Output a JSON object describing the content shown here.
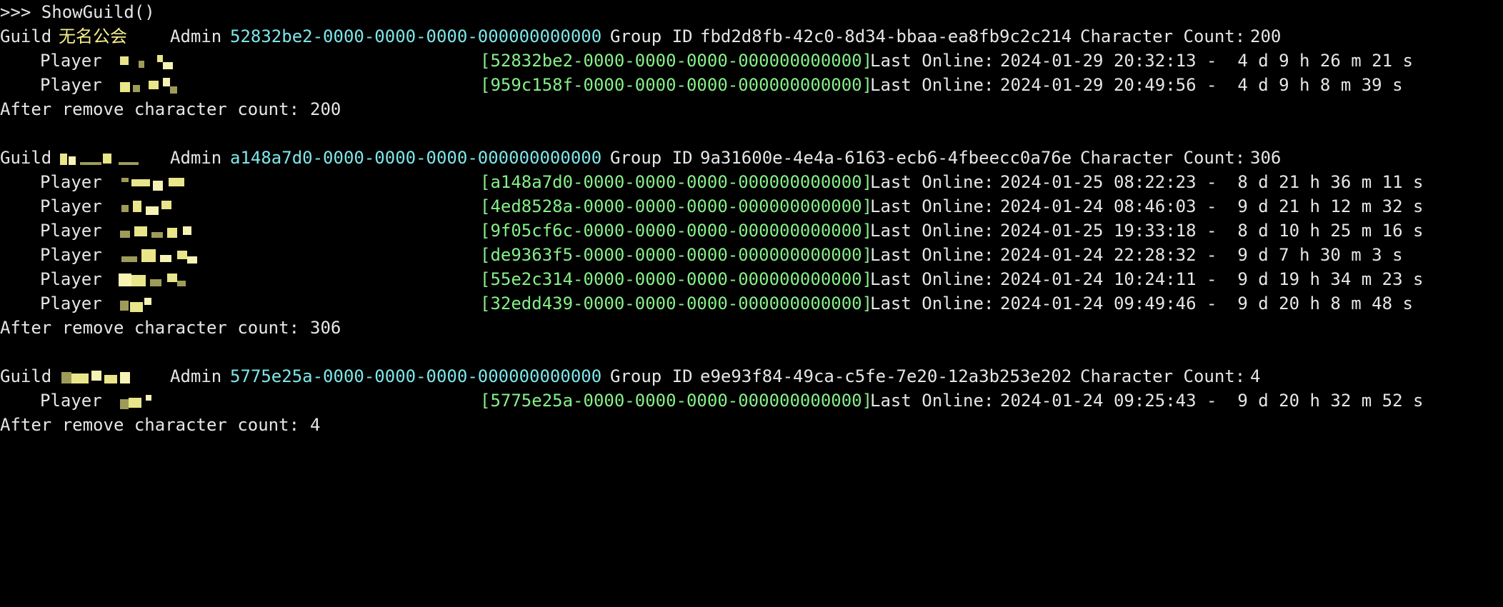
{
  "prompt_command": ">>> ShowGuild()",
  "labels": {
    "guild": "Guild",
    "admin": "Admin",
    "group_id": "Group ID",
    "character_count": "Character Count:",
    "player": "Player",
    "last_online": "Last Online:",
    "after_remove": "After remove character count:"
  },
  "guilds": [
    {
      "name": "无名公会",
      "admin": "52832be2-0000-0000-0000-000000000000",
      "group_id": "fbd2d8fb-42c0-8d34-bbaa-ea8fb9c2c214",
      "character_count": "200",
      "players": [
        {
          "uid": "[52832be2-0000-0000-0000-000000000000]",
          "last_online": "2024-01-29 20:32:13 -  4 d 9 h 26 m 21 s"
        },
        {
          "uid": "[959c158f-0000-0000-0000-000000000000]",
          "last_online": "2024-01-29 20:49:56 -  4 d 9 h 8 m 39 s"
        }
      ],
      "after_count": "200"
    },
    {
      "name": "",
      "admin": "a148a7d0-0000-0000-0000-000000000000",
      "group_id": "9a31600e-4e4a-6163-ecb6-4fbeecc0a76e",
      "character_count": "306",
      "players": [
        {
          "uid": "[a148a7d0-0000-0000-0000-000000000000]",
          "last_online": "2024-01-25 08:22:23 -  8 d 21 h 36 m 11 s"
        },
        {
          "uid": "[4ed8528a-0000-0000-0000-000000000000]",
          "last_online": "2024-01-24 08:46:03 -  9 d 21 h 12 m 32 s"
        },
        {
          "uid": "[9f05cf6c-0000-0000-0000-000000000000]",
          "last_online": "2024-01-25 19:33:18 -  8 d 10 h 25 m 16 s"
        },
        {
          "uid": "[de9363f5-0000-0000-0000-000000000000]",
          "last_online": "2024-01-24 22:28:32 -  9 d 7 h 30 m 3 s"
        },
        {
          "uid": "[55e2c314-0000-0000-0000-000000000000]",
          "last_online": "2024-01-24 10:24:11 -  9 d 19 h 34 m 23 s"
        },
        {
          "uid": "[32edd439-0000-0000-0000-000000000000]",
          "last_online": "2024-01-24 09:49:46 -  9 d 20 h 8 m 48 s"
        }
      ],
      "after_count": "306"
    },
    {
      "name": "",
      "admin": "5775e25a-0000-0000-0000-000000000000",
      "group_id": "e9e93f84-49ca-c5fe-7e20-12a3b253e202",
      "character_count": "4",
      "players": [
        {
          "uid": "[5775e25a-0000-0000-0000-000000000000]",
          "last_online": "2024-01-24 09:25:43 -  9 d 20 h 32 m 52 s"
        }
      ],
      "after_count": "4"
    }
  ],
  "colors": {
    "background": "#000000",
    "text": "#e6e6e6",
    "guild_name": "#f5ef88",
    "admin_uid": "#7fe6e9",
    "player_uid": "#86f088"
  }
}
